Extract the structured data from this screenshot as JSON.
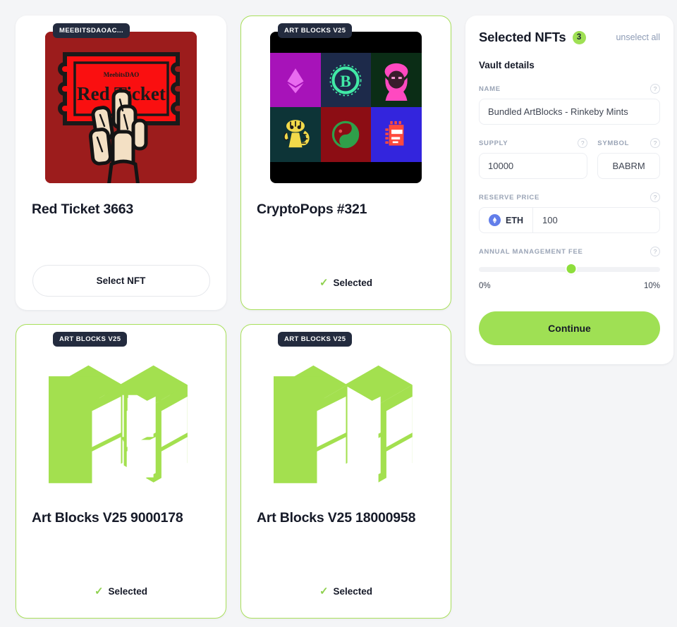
{
  "cards": [
    {
      "badge": "MEEBITSDAOAC...",
      "title": "Red Ticket 3663",
      "art": "red-ticket",
      "selected": false,
      "action_label": "Select NFT",
      "ticket_brand": "MeebitsDAO",
      "ticket_text": "Red Ticket"
    },
    {
      "badge": "ART BLOCKS V25",
      "title": "CryptoPops #321",
      "art": "crypto-pops-grid",
      "selected": true,
      "action_label": "Selected"
    },
    {
      "badge": "ART BLOCKS V25",
      "title": "Art Blocks V25 9000178",
      "art": "art-blocks-logo",
      "selected": true,
      "action_label": "Selected"
    },
    {
      "badge": "ART BLOCKS V25",
      "title": "Art Blocks V25 18000958",
      "art": "art-blocks-logo",
      "selected": true,
      "action_label": "Selected"
    }
  ],
  "panel": {
    "title": "Selected NFTs",
    "count": "3",
    "unselect_all_label": "unselect all",
    "vault_details_label": "Vault details",
    "help_glyph": "?",
    "fields": {
      "name": {
        "label": "NAME",
        "value": "Bundled ArtBlocks - Rinkeby Mints"
      },
      "supply": {
        "label": "SUPPLY",
        "value": "10000"
      },
      "symbol": {
        "label": "SYMBOL",
        "value": "BABRM"
      },
      "reserve_price": {
        "label": "RESERVE PRICE",
        "currency": "ETH",
        "value": "100"
      },
      "annual_management_fee": {
        "label": "ANNUAL MANAGEMENT FEE",
        "min_label": "0%",
        "max_label": "10%",
        "value_percent": 5.1
      }
    },
    "continue_label": "Continue"
  },
  "colors": {
    "accent_green": "#9fe054",
    "selected_border": "#a9e05c",
    "badge_dark": "#232b3e",
    "page_background": "#f4f5f7",
    "link_muted": "#8d9bb5",
    "eth_blue": "#627eea"
  }
}
